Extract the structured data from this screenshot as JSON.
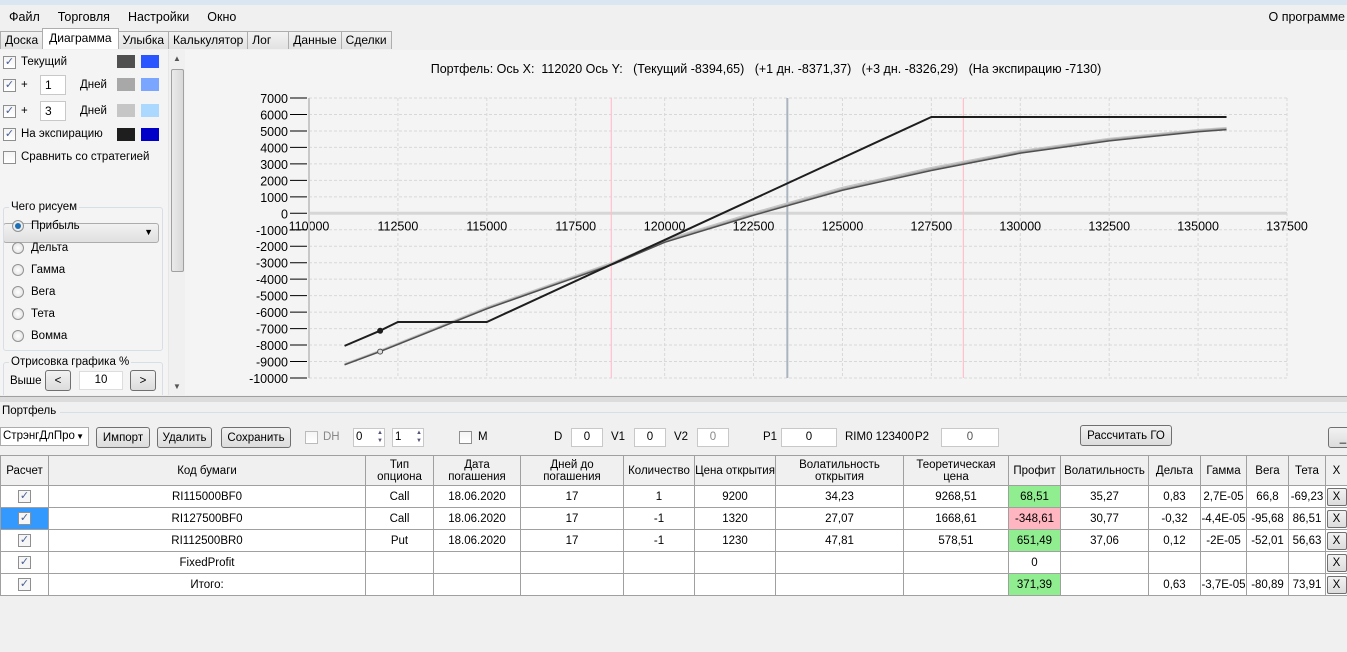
{
  "menu": {
    "items": [
      "Файл",
      "Торговля",
      "Настройки",
      "Окно"
    ],
    "about": "О программе"
  },
  "tabs": [
    "Доска",
    "Диаграмма",
    "Улыбка",
    "Калькулятор",
    "Лог",
    "Данные",
    "Сделки"
  ],
  "active_tab": "Диаграмма",
  "left": {
    "current": {
      "label": "Текущий",
      "checked": true,
      "colors": [
        "#505050",
        "#2a56ff"
      ]
    },
    "plus1": {
      "plus": "+",
      "value": "1",
      "unit": "Дней",
      "checked": true,
      "colors": [
        "#a8a8a8",
        "#7ba6ff"
      ]
    },
    "plus3": {
      "plus": "+",
      "value": "3",
      "unit": "Дней",
      "checked": true,
      "colors": [
        "#c6c6c6",
        "#aad8ff"
      ]
    },
    "expiry": {
      "label": "На экспирацию",
      "checked": true,
      "colors": [
        "#1e1e1e",
        "#0000c8"
      ]
    },
    "compare": {
      "label": "Сравнить со стратегией",
      "checked": false
    },
    "draw_group": "Чего рисуем",
    "draw_options": [
      "Прибыль",
      "Дельта",
      "Гамма",
      "Вега",
      "Тета",
      "Вомма"
    ],
    "draw_selected": "Прибыль",
    "render_group": "Отрисовка графика %",
    "above_label": "Выше",
    "above_value": "10",
    "dec": "<",
    "inc": ">"
  },
  "chart_data": {
    "type": "line",
    "title": "Портфель: Ось X:  112020 Ось Y:   (Текущий -8394,65)   (+1 дн. -8371,37)   (+3 дн. -8326,29)   (На экспирацию -7130)",
    "xlim": [
      110000,
      137500
    ],
    "ylim": [
      -10000,
      7000
    ],
    "xticks": [
      "110000",
      "112500",
      "115000",
      "117500",
      "120000",
      "122500",
      "125000",
      "127500",
      "130000",
      "132500",
      "135000",
      "137500"
    ],
    "yticks": [
      "7000",
      "6000",
      "5000",
      "4000",
      "3000",
      "2000",
      "1000",
      "0",
      "-1000",
      "-2000",
      "-3000",
      "-4000",
      "-5000",
      "-6000",
      "-7000",
      "-8000",
      "-9000",
      "-10000"
    ],
    "grid": true,
    "vlines": [
      {
        "x": 118500,
        "color": "#ffc0cb"
      },
      {
        "x": 128400,
        "color": "#ffc0cb"
      },
      {
        "x": 123450,
        "color": "#a9b4bf"
      }
    ],
    "cursor_x": 112020,
    "series": [
      {
        "id": "current",
        "color": "#505050",
        "x": [
          111000,
          112000,
          115000,
          118600,
          120000,
          122500,
          125000,
          127500,
          130000,
          132500,
          135000,
          135800
        ],
        "y": [
          -9200,
          -8395,
          -5800,
          -3050,
          -1760,
          -120,
          1400,
          2600,
          3650,
          4400,
          4950,
          5080
        ]
      },
      {
        "id": "plus1",
        "color": "#a8a8a8",
        "x": [
          111000,
          112000,
          115000,
          118600,
          120000,
          122500,
          125000,
          127500,
          130000,
          132500,
          135000,
          135800
        ],
        "y": [
          -9180,
          -8371,
          -5760,
          -3000,
          -1700,
          -50,
          1480,
          2680,
          3720,
          4470,
          5010,
          5140
        ]
      },
      {
        "id": "plus3",
        "color": "#c6c6c6",
        "x": [
          111000,
          112000,
          115000,
          118600,
          120000,
          122500,
          125000,
          127500,
          130000,
          132500,
          135000,
          135800
        ],
        "y": [
          -9140,
          -8326,
          -5700,
          -2930,
          -1620,
          40,
          1570,
          2770,
          3800,
          4540,
          5070,
          5200
        ]
      },
      {
        "id": "expiry",
        "color": "#1e1e1e",
        "x": [
          111000,
          112000,
          112500,
          115000,
          127500,
          135800
        ],
        "y": [
          -8050,
          -7130,
          -6600,
          -6600,
          5850,
          5850
        ]
      }
    ]
  },
  "portfolio": {
    "group": "Портфель",
    "strategy": "СтрэнгДлПро",
    "import": "Импорт",
    "delete": "Удалить",
    "save": "Сохранить",
    "dh": "DH",
    "spin1": "0",
    "spin2": "1",
    "m": "M",
    "d_label": "D",
    "d": "0",
    "v1_label": "V1",
    "v1": "0",
    "v2_label": "V2",
    "v2": "0",
    "p1_label": "P1",
    "p1": "0",
    "rim": "RIM0 123400",
    "p2_label": "P2",
    "p2": "0",
    "calc": "Рассчитать ГО",
    "min": "_"
  },
  "table": {
    "headers": [
      "Расчет",
      "Код бумаги",
      "Тип опциона",
      "Дата погашения",
      "Дней до погашения",
      "Количество",
      "Цена открытия",
      "Волатильность открытия",
      "Теоретическая цена",
      "Профит",
      "Волатильность",
      "Дельта",
      "Гамма",
      "Вега",
      "Тета",
      "X"
    ],
    "rows": [
      [
        "✓",
        "RI115000BF0",
        "Call",
        "18.06.2020",
        "17",
        "1",
        "9200",
        "34,23",
        "9268,51",
        "68,51",
        "35,27",
        "0,83",
        "2,7E-05",
        "66,8",
        "-69,23",
        "X"
      ],
      [
        "✓",
        "RI127500BF0",
        "Call",
        "18.06.2020",
        "17",
        "-1",
        "1320",
        "27,07",
        "1668,61",
        "-348,61",
        "30,77",
        "-0,32",
        "-4,4E-05",
        "-95,68",
        "86,51",
        "X"
      ],
      [
        "✓",
        "RI112500BR0",
        "Put",
        "18.06.2020",
        "17",
        "-1",
        "1230",
        "47,81",
        "578,51",
        "651,49",
        "37,06",
        "0,12",
        "-2E-05",
        "-52,01",
        "56,63",
        "X"
      ],
      [
        "✓",
        "FixedProfit",
        "",
        "",
        "",
        "",
        "",
        "",
        "",
        "0",
        "",
        "",
        "",
        "",
        "",
        "X"
      ],
      [
        "✓",
        "Итого:",
        "",
        "",
        "",
        "",
        "",
        "",
        "",
        "371,39",
        "",
        "0,63",
        "-3,7E-05",
        "-80,89",
        "73,91",
        "X"
      ]
    ],
    "profit_status": [
      "pos",
      "neg",
      "pos",
      "",
      "pos"
    ]
  }
}
